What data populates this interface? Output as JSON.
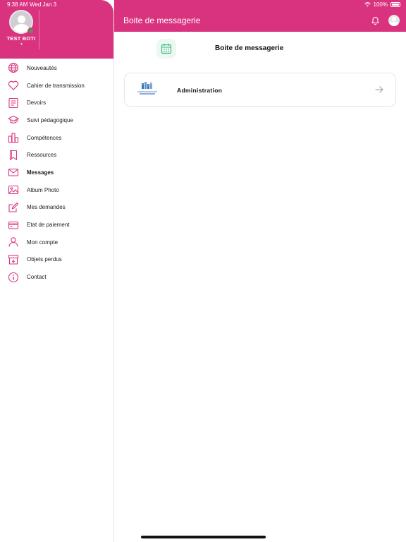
{
  "status_bar": {
    "time": "9:38 AM",
    "date": "Wed Jan 3",
    "battery": "100%"
  },
  "header": {
    "title": "Boite de messagerie"
  },
  "user": {
    "name": "TEST BOTI"
  },
  "sidebar": {
    "items": [
      {
        "label": "Nouveautés",
        "icon": "globe-icon"
      },
      {
        "label": "Cahier de transmission",
        "icon": "heart-icon"
      },
      {
        "label": "Devoirs",
        "icon": "homework-icon"
      },
      {
        "label": "Suivi pédagogique",
        "icon": "graduation-cap-icon"
      },
      {
        "label": "Compétences",
        "icon": "bar-chart-icon"
      },
      {
        "label": "Ressources",
        "icon": "bookmark-icon"
      },
      {
        "label": "Messages",
        "icon": "mail-icon",
        "active": true
      },
      {
        "label": "Album Photo",
        "icon": "photo-icon"
      },
      {
        "label": "Mes demandes",
        "icon": "edit-icon"
      },
      {
        "label": "Etat de paiement",
        "icon": "credit-card-icon"
      },
      {
        "label": "Mon compte",
        "icon": "user-icon"
      },
      {
        "label": "Objets perdus",
        "icon": "archive-icon"
      },
      {
        "label": "Contact",
        "icon": "info-icon"
      }
    ]
  },
  "main": {
    "section_title": "Boite de messagerie",
    "inbox": [
      {
        "label": "Administration"
      }
    ]
  },
  "colors": {
    "brand": "#d9337f",
    "accent_green": "#3dbd7d",
    "text": "#1c1c1c"
  }
}
